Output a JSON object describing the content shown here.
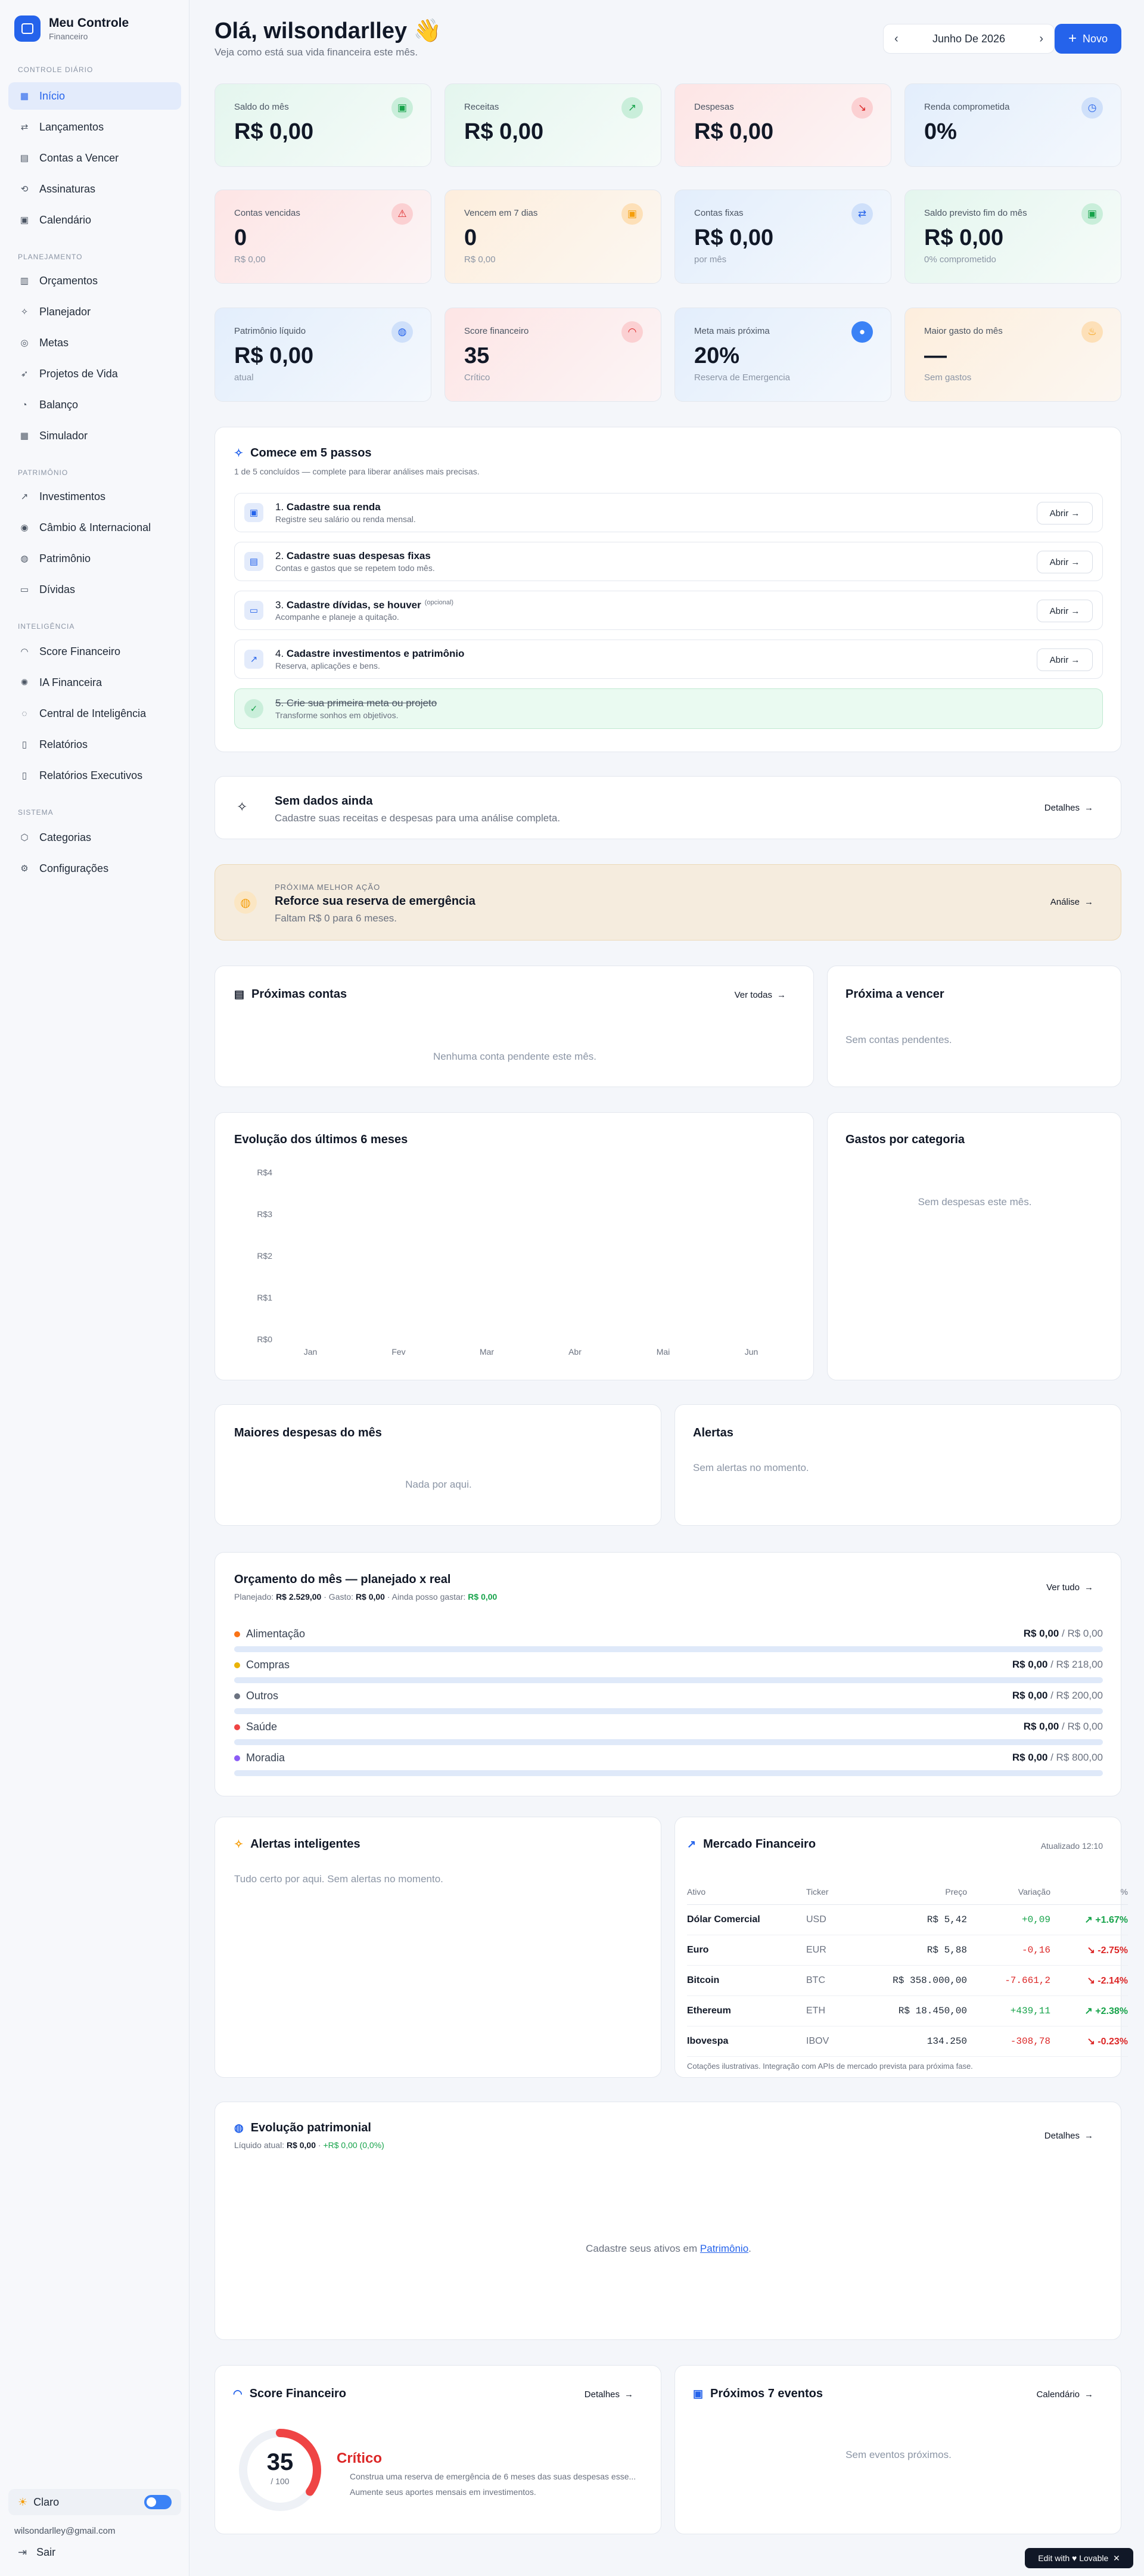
{
  "brand": {
    "title": "Meu Controle",
    "subtitle": "Financeiro"
  },
  "nav": {
    "sections": [
      "Controle diário",
      "Planejamento",
      "Patrimônio",
      "Inteligência",
      "Sistema"
    ],
    "items": [
      "Início",
      "Lançamentos",
      "Contas a Vencer",
      "Assinaturas",
      "Calendário",
      "Orçamentos",
      "Planejador",
      "Metas",
      "Projetos de Vida",
      "Balanço",
      "Simulador",
      "Investimentos",
      "Câmbio & Internacional",
      "Patrimônio",
      "Dívidas",
      "Score Financeiro",
      "IA Financeira",
      "Central de Inteligência",
      "Relatórios",
      "Relatórios Executivos",
      "Categorias",
      "Configurações"
    ],
    "theme": "Claro",
    "email": "wilsondarlley@gmail.com",
    "logout": "Sair"
  },
  "header": {
    "greeting": "Olá, wilsondarlley 👋",
    "subtitle": "Veja como está sua vida financeira este mês.",
    "month": "Junho De 2026",
    "new_label": "Novo"
  },
  "kpis": [
    {
      "label": "Saldo do mês",
      "value": "R$ 0,00",
      "sub": ""
    },
    {
      "label": "Receitas",
      "value": "R$ 0,00",
      "sub": ""
    },
    {
      "label": "Despesas",
      "value": "R$ 0,00",
      "sub": ""
    },
    {
      "label": "Renda comprometida",
      "value": "0%",
      "sub": ""
    },
    {
      "label": "Contas vencidas",
      "value": "0",
      "sub": "R$ 0,00"
    },
    {
      "label": "Vencem em 7 dias",
      "value": "0",
      "sub": "R$ 0,00"
    },
    {
      "label": "Contas fixas",
      "value": "R$ 0,00",
      "sub": "por mês"
    },
    {
      "label": "Saldo previsto fim do mês",
      "value": "R$ 0,00",
      "sub": "0% comprometido"
    },
    {
      "label": "Patrimônio líquido",
      "value": "R$ 0,00",
      "sub": "atual"
    },
    {
      "label": "Score financeiro",
      "value": "35",
      "sub": "Crítico"
    },
    {
      "label": "Meta mais próxima",
      "value": "20%",
      "sub": "Reserva de Emergencia"
    },
    {
      "label": "Maior gasto do mês",
      "value": "—",
      "sub": "Sem gastos"
    }
  ],
  "steps": {
    "title": "Comece em 5 passos",
    "subtitle": "1 de 5 concluídos — complete para liberar análises mais precisas.",
    "open_label": "Abrir",
    "items": [
      {
        "num": "1.",
        "title": "Cadastre sua renda",
        "desc": "Registre seu salário ou renda mensal.",
        "opt": ""
      },
      {
        "num": "2.",
        "title": "Cadastre suas despesas fixas",
        "desc": "Contas e gastos que se repetem todo mês.",
        "opt": ""
      },
      {
        "num": "3.",
        "title": "Cadastre dívidas, se houver",
        "desc": "Acompanhe e planeje a quitação.",
        "opt": "(opcional)"
      },
      {
        "num": "4.",
        "title": "Cadastre investimentos e patrimônio",
        "desc": "Reserva, aplicações e bens.",
        "opt": ""
      },
      {
        "num": "5.",
        "title": "Crie sua primeira meta ou projeto",
        "desc": "Transforme sonhos em objetivos.",
        "opt": ""
      }
    ]
  },
  "nodata": {
    "title": "Sem dados ainda",
    "desc": "Cadastre suas receitas e despesas para uma análise completa.",
    "action": "Detalhes"
  },
  "nextaction": {
    "eyebrow": "PRÓXIMA MELHOR AÇÃO",
    "title": "Reforce sua reserva de emergência",
    "desc": "Faltam R$ 0 para 6 meses.",
    "action": "Análise"
  },
  "upcoming": {
    "title": "Próximas contas",
    "action": "Ver todas",
    "empty": "Nenhuma conta pendente este mês."
  },
  "nextdue": {
    "title": "Próxima a vencer",
    "empty": "Sem contas pendentes."
  },
  "evolution": {
    "title": "Evolução dos últimos 6 meses"
  },
  "chart_data": {
    "type": "line",
    "categories": [
      "Jan",
      "Fev",
      "Mar",
      "Abr",
      "Mai",
      "Jun"
    ],
    "y_ticks": [
      "R$0",
      "R$1",
      "R$2",
      "R$3",
      "R$4"
    ],
    "ylim": [
      0,
      4
    ],
    "series": []
  },
  "bycat": {
    "title": "Gastos por categoria",
    "empty": "Sem despesas este mês."
  },
  "topexp": {
    "title": "Maiores despesas do mês",
    "empty": "Nada por aqui."
  },
  "alerts": {
    "title": "Alertas",
    "empty": "Sem alertas no momento."
  },
  "budget": {
    "title": "Orçamento do mês — planejado x real",
    "s1": "Planejado:",
    "planned": "R$ 2.529,00",
    "s2": " · Gasto:",
    "spent": "R$ 0,00",
    "s3": " · Ainda posso gastar:",
    "remaining": "R$ 0,00",
    "action": "Ver tudo",
    "rows": [
      {
        "name": "Alimentação",
        "spent": "R$ 0,00",
        "planned": "/ R$ 0,00",
        "color": "#f97316"
      },
      {
        "name": "Compras",
        "spent": "R$ 0,00",
        "planned": "/ R$ 218,00",
        "color": "#eab308"
      },
      {
        "name": "Outros",
        "spent": "R$ 0,00",
        "planned": "/ R$ 200,00",
        "color": "#6b7280"
      },
      {
        "name": "Saúde",
        "spent": "R$ 0,00",
        "planned": "/ R$ 0,00",
        "color": "#ef4444"
      },
      {
        "name": "Moradia",
        "spent": "R$ 0,00",
        "planned": "/ R$ 800,00",
        "color": "#8b5cf6"
      }
    ]
  },
  "smart": {
    "title": "Alertas inteligentes",
    "empty": "Tudo certo por aqui. Sem alertas no momento."
  },
  "market": {
    "title": "Mercado Financeiro",
    "updated": "Atualizado 12:10",
    "cols": [
      "Ativo",
      "Ticker",
      "Preço",
      "Variação",
      "%"
    ],
    "rows": [
      {
        "name": "Dólar Comercial",
        "ticker": "USD",
        "price": "R$ 5,42",
        "var": "+0,09",
        "pct": "+1.67%",
        "up": true
      },
      {
        "name": "Euro",
        "ticker": "EUR",
        "price": "R$ 5,88",
        "var": "-0,16",
        "pct": "-2.75%",
        "up": false
      },
      {
        "name": "Bitcoin",
        "ticker": "BTC",
        "price": "R$ 358.000,00",
        "var": "-7.661,2",
        "pct": "-2.14%",
        "up": false
      },
      {
        "name": "Ethereum",
        "ticker": "ETH",
        "price": "R$ 18.450,00",
        "var": "+439,11",
        "pct": "+2.38%",
        "up": true
      },
      {
        "name": "Ibovespa",
        "ticker": "IBOV",
        "price": "134.250",
        "var": "-308,78",
        "pct": "-0.23%",
        "up": false
      }
    ],
    "note": "Cotações ilustrativas. Integração com APIs de mercado prevista para próxima fase."
  },
  "patrimonial": {
    "title": "Evolução patrimonial",
    "s1": "Líquido atual:",
    "current": "R$ 0,00",
    "change": "+R$ 0,00 (0,0%)",
    "action": "Detalhes",
    "empty_prefix": "Cadastre seus ativos em ",
    "empty_link": "Patrimônio",
    "empty_suffix": "."
  },
  "score": {
    "title": "Score Financeiro",
    "action": "Detalhes",
    "value": "35",
    "max": "/ 100",
    "status": "Crítico",
    "fraction": 0.35,
    "tips": [
      "Construa uma reserva de emergência de 6 meses das suas despesas esse...",
      "Aumente seus aportes mensais em investimentos."
    ]
  },
  "events": {
    "title": "Próximos 7 eventos",
    "action": "Calendário",
    "empty": "Sem eventos próximos."
  },
  "badge": "Edit with ♥ Lovable"
}
